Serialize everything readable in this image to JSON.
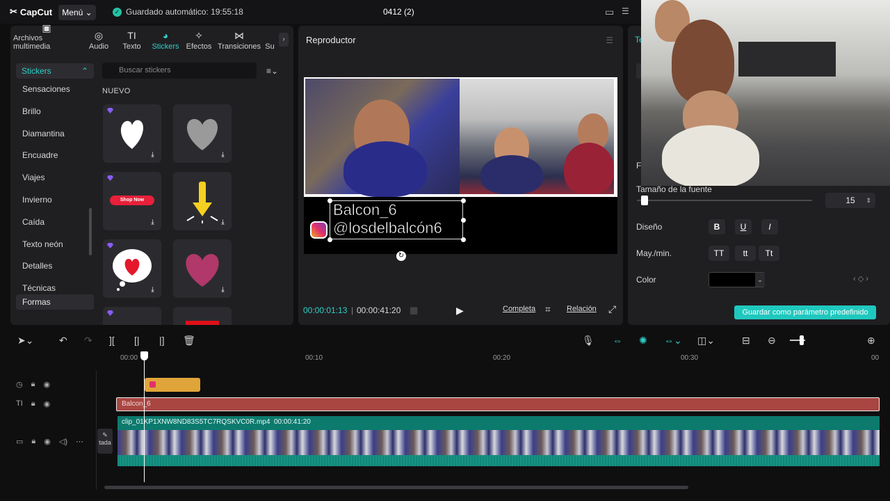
{
  "app": {
    "brand": "CapCut",
    "menu": "Menú",
    "autosave": "Guardado automático: 19:55:18",
    "project": "0412 (2)"
  },
  "tabs": [
    {
      "label": "Archivos multimedia",
      "icon": "media-icon"
    },
    {
      "label": "Audio",
      "icon": "audio-icon"
    },
    {
      "label": "Texto",
      "icon": "text-icon"
    },
    {
      "label": "Stickers",
      "icon": "stickers-icon"
    },
    {
      "label": "Efectos",
      "icon": "effects-icon"
    },
    {
      "label": "Transiciones",
      "icon": "transitions-icon"
    },
    {
      "label": "Su",
      "icon": ""
    }
  ],
  "categories": {
    "header": "Stickers",
    "items": [
      "Sensaciones",
      "Brillo",
      "Diamantina",
      "Encuadre",
      "Viajes",
      "Invierno",
      "Caída",
      "Texto neón",
      "Detalles",
      "Técnicas"
    ],
    "selected": "Formas"
  },
  "search": {
    "placeholder": "Buscar stickers"
  },
  "section": "NUEVO",
  "stickers": {
    "shop_now": "Shop Now"
  },
  "player": {
    "title": "Reproductor",
    "overlay_line1": "Balcon_6",
    "overlay_line2": "@losdelbalcón6",
    "current_time": "00:00:01:13",
    "total_time": "00:00:41:20",
    "btn_full": "Completa",
    "btn_ratio": "Relación"
  },
  "right": {
    "tab_label": "Te",
    "font_label_partial": "Fu",
    "font_size_label": "Tamaño de la fuente",
    "font_size_value": "15",
    "design_label": "Diseño",
    "case_label": "May./min.",
    "case_upper": "TT",
    "case_lower": "tt",
    "case_title": "Tt",
    "color_label": "Color",
    "color_value": "#000000",
    "save_preset": "Guardar como parámetro predefinido"
  },
  "timeline": {
    "ruler": [
      "00:00",
      "00:10",
      "00:20",
      "00:30",
      "00"
    ],
    "text_clip": "Balcon_6",
    "video_clip": "clip_01KP1XNW8ND83S5TC7RQSKVC0R.mp4",
    "video_duration": "00:00:41:20",
    "cover_label": "tada"
  },
  "colors": {
    "accent": "#2fd0c8",
    "text_clip": "#a94642",
    "video_clip": "#0d7a6e",
    "sticker_clip": "#e0a53a"
  }
}
